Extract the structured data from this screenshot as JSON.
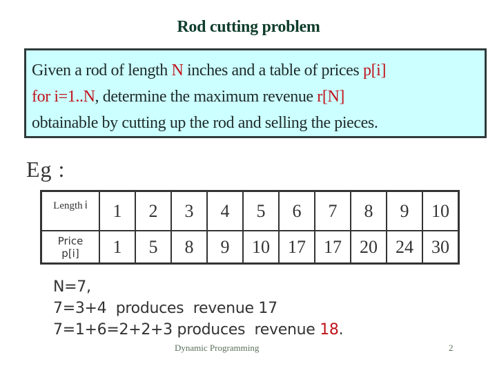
{
  "slide": {
    "title": "Rod cutting problem",
    "definition": {
      "line1": {
        "pre": "Given a rod of length ",
        "N": "N",
        "mid": " inches and a table of prices ",
        "p": "p[i]"
      },
      "line2": {
        "for": "for i=1..N",
        "mid": ", determine the maximum revenue ",
        "r": "r[N]"
      },
      "line3": "obtainable by cutting up the rod and selling the pieces."
    },
    "eg_label": "Eg :",
    "table": {
      "length_label": "Length",
      "length_var": "i",
      "price_label": "Price",
      "price_var": "p[i]",
      "lengths": [
        "1",
        "2",
        "3",
        "4",
        "5",
        "6",
        "7",
        "8",
        "9",
        "10"
      ],
      "prices": [
        "1",
        "5",
        "8",
        "9",
        "10",
        "17",
        "17",
        "20",
        "24",
        "30"
      ]
    },
    "example": {
      "line1": "N=7,",
      "line2": "7=3+4  produces  revenue 17",
      "line3_pre": "7=1+6=2+2+3 produces  revenue ",
      "line3_value": "18",
      "line3_post": "."
    },
    "footer": "Dynamic Programming",
    "page_number": "2"
  },
  "colors": {
    "highlight": "#c0131b",
    "box_background": "#ccffff",
    "title": "#0f3d2c"
  }
}
